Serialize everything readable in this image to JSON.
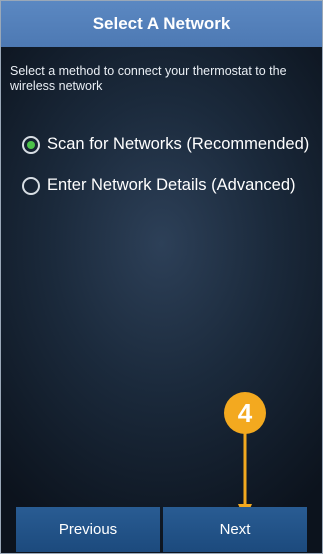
{
  "header": {
    "title": "Select A Network"
  },
  "instruction": "Select a method to connect your thermostat to the wireless network",
  "options": [
    {
      "label": "Scan for Networks (Recommended)",
      "selected": true
    },
    {
      "label": "Enter Network Details (Advanced)",
      "selected": false
    }
  ],
  "buttons": {
    "previous": "Previous",
    "next": "Next"
  },
  "callout": {
    "number": "4"
  },
  "colors": {
    "header": "#5480bb",
    "radio_selected": "#4cc24a",
    "button": "#235489",
    "callout": "#f3a91f"
  },
  "icons": {
    "callout_arrow": "arrow-down-icon"
  }
}
